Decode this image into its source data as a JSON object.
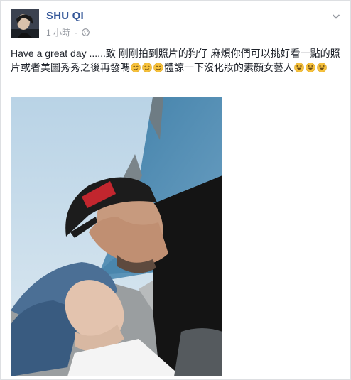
{
  "post": {
    "author": "SHU QI",
    "timestamp": "1 小時",
    "separator": "·",
    "privacy_icon": "globe-icon",
    "menu_icon": "chevron-down-icon",
    "text_before_emoji": "Have a great day ......致 剛剛拍到照片的狗仔 麻煩你們可以挑好看一點的照片或者美圖秀秀之後再發嗎",
    "emoji_group_1": [
      "smirk-emoji",
      "smirk-emoji",
      "smirk-emoji"
    ],
    "text_after_emoji": "體諒一下沒化妝的素顏女藝人",
    "emoji_group_2": [
      "laughing-emoji",
      "laughing-emoji",
      "laughing-emoji"
    ]
  },
  "colors": {
    "author_blue": "#365899",
    "meta_gray": "#90949c",
    "text": "#1d2129",
    "emoji_yellow": "#f7c23c"
  }
}
